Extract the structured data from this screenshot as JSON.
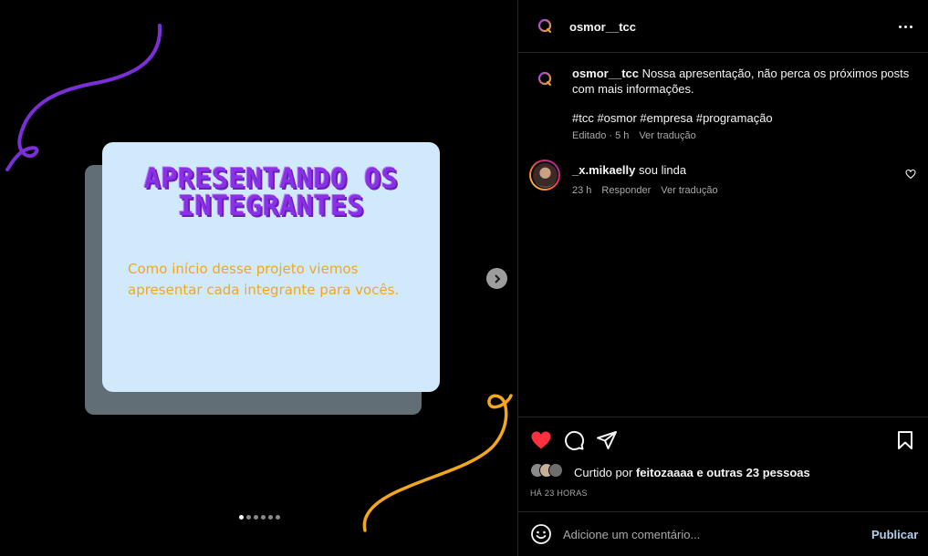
{
  "post": {
    "slide": {
      "title": "APRESENTANDO OS INTEGRANTES",
      "body": "Como início desse projeto viemos apresentar cada integrante para vocês."
    },
    "carousel_total": 6,
    "carousel_active": 1
  },
  "header": {
    "username": "osmor__tcc"
  },
  "caption": {
    "username": "osmor__tcc",
    "text": "Nossa apresentação, não perca os próximos posts com mais informações.",
    "hashtags": "#tcc #osmor #empresa #programação",
    "edited": "Editado · 5 h",
    "see_translation": "Ver tradução"
  },
  "comment": {
    "username": "_x.mikaelly",
    "text": "sou linda",
    "time": "23 h",
    "reply": "Responder",
    "see_translation": "Ver tradução"
  },
  "likes": {
    "prefix": "Curtido por",
    "user": "feitozaaaa",
    "suffix": "e outras 23 pessoas"
  },
  "post_time": "HÁ 23 HORAS",
  "comment_box": {
    "placeholder": "Adicione um comentário...",
    "publish": "Publicar"
  },
  "colors": {
    "like_red": "#ff3040",
    "accent_purple": "#8a30e6",
    "accent_orange": "#f2a71d",
    "card_bg": "#d1eafb",
    "publish_blue": "#b3cdee"
  },
  "icons": [
    "osmor-logo-icon",
    "more-icon",
    "heart-icon",
    "comment-icon",
    "share-icon",
    "bookmark-icon",
    "emoji-icon",
    "chevron-right-icon"
  ]
}
